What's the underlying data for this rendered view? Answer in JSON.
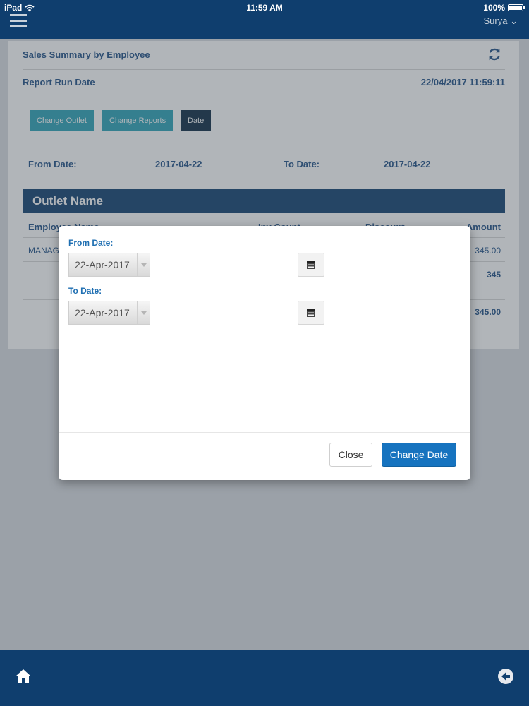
{
  "statusbar": {
    "device": "iPad",
    "time": "11:59 AM",
    "battery": "100%"
  },
  "header": {
    "user": "Surya"
  },
  "report": {
    "title": "Sales Summary by Employee",
    "run_date_label": "Report Run Date",
    "run_date_value": "22/04/2017 11:59:11",
    "tabs": [
      {
        "label": "Change Outlet"
      },
      {
        "label": "Change Reports"
      },
      {
        "label": "Date"
      }
    ],
    "from_label": "From Date:",
    "from_value": "2017-04-22",
    "to_label": "To Date:",
    "to_value": "2017-04-22",
    "outlet_title": "Outlet Name",
    "columns": [
      "Employee Name",
      "Inv Count",
      "Discount",
      "Amount"
    ],
    "row_employee": "MANAGER",
    "row_amount": "345.00",
    "subtotal": "345",
    "total": "345.00"
  },
  "modal": {
    "from_label": "From Date:",
    "from_value": "22-Apr-2017",
    "to_label": "To Date:",
    "to_value": "22-Apr-2017",
    "close_label": "Close",
    "change_label": "Change Date"
  },
  "icons": {
    "menu": "hamburger-icon",
    "refresh": "refresh-icon",
    "calendar": "calendar-icon",
    "home": "home-icon",
    "back": "back-arrow-icon"
  },
  "colors": {
    "brand": "#0f3e6e",
    "tab": "#2aa3b7",
    "primary": "#1673bf"
  }
}
